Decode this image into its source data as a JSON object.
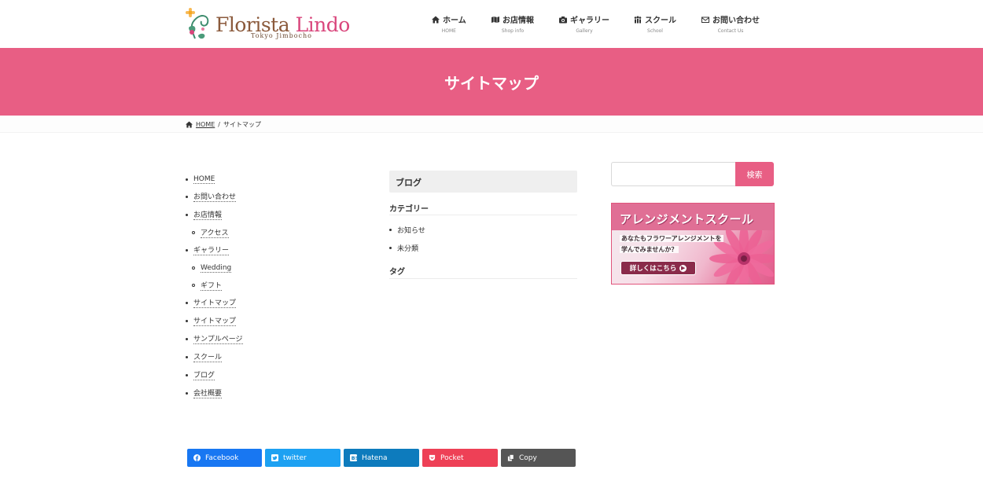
{
  "logo": {
    "name_part1": "Florista ",
    "name_part2": "Lindo",
    "subtitle": "Tokyo Jimbocho"
  },
  "nav": [
    {
      "label": "ホーム",
      "sub": "HOME",
      "icon": "home-icon"
    },
    {
      "label": "お店情報",
      "sub": "Shop info",
      "icon": "map-icon"
    },
    {
      "label": "ギャラリー",
      "sub": "Gallery",
      "icon": "camera-icon"
    },
    {
      "label": "スクール",
      "sub": "School",
      "icon": "users-icon"
    },
    {
      "label": "お問い合わせ",
      "sub": "Contact Us",
      "icon": "mail-icon"
    }
  ],
  "page_title": "サイトマップ",
  "breadcrumb": {
    "home": "HOME",
    "separator": "/",
    "current": "サイトマップ"
  },
  "sitemap": [
    {
      "label": "HOME",
      "child": false
    },
    {
      "label": "お問い合わせ",
      "child": false
    },
    {
      "label": "お店情報",
      "child": false
    },
    {
      "label": "アクセス",
      "child": true
    },
    {
      "label": "ギャラリー",
      "child": false
    },
    {
      "label": "Wedding",
      "child": true
    },
    {
      "label": "ギフト",
      "child": true
    },
    {
      "label": "サイトマップ",
      "child": false
    },
    {
      "label": "サイトマップ",
      "child": false
    },
    {
      "label": "サンプルページ",
      "child": false
    },
    {
      "label": "スクール",
      "child": false
    },
    {
      "label": "ブログ",
      "child": false
    },
    {
      "label": "会社概要",
      "child": false
    }
  ],
  "blog": {
    "heading": "ブログ",
    "category_heading": "カテゴリー",
    "categories": [
      "お知らせ",
      "未分類"
    ],
    "tag_heading": "タグ"
  },
  "search": {
    "placeholder": "",
    "button": "検索"
  },
  "banner": {
    "title": "アレンジメントスクール",
    "line1": "あなたもフラワーアレンジメントを",
    "line2": "学んでみませんか？",
    "button": "詳しくはこちら"
  },
  "share": [
    {
      "label": "Facebook",
      "color": "#1877f2",
      "icon": "facebook-icon"
    },
    {
      "label": "twitter",
      "color": "#1da1f2",
      "icon": "twitter-icon"
    },
    {
      "label": "Hatena",
      "color": "#0d7bbd",
      "icon": "hatena-icon"
    },
    {
      "label": "Pocket",
      "color": "#ee4056",
      "icon": "pocket-icon"
    },
    {
      "label": "Copy",
      "color": "#555555",
      "icon": "copy-icon"
    }
  ],
  "colors": {
    "accent": "#e85e84",
    "text": "#333333"
  }
}
